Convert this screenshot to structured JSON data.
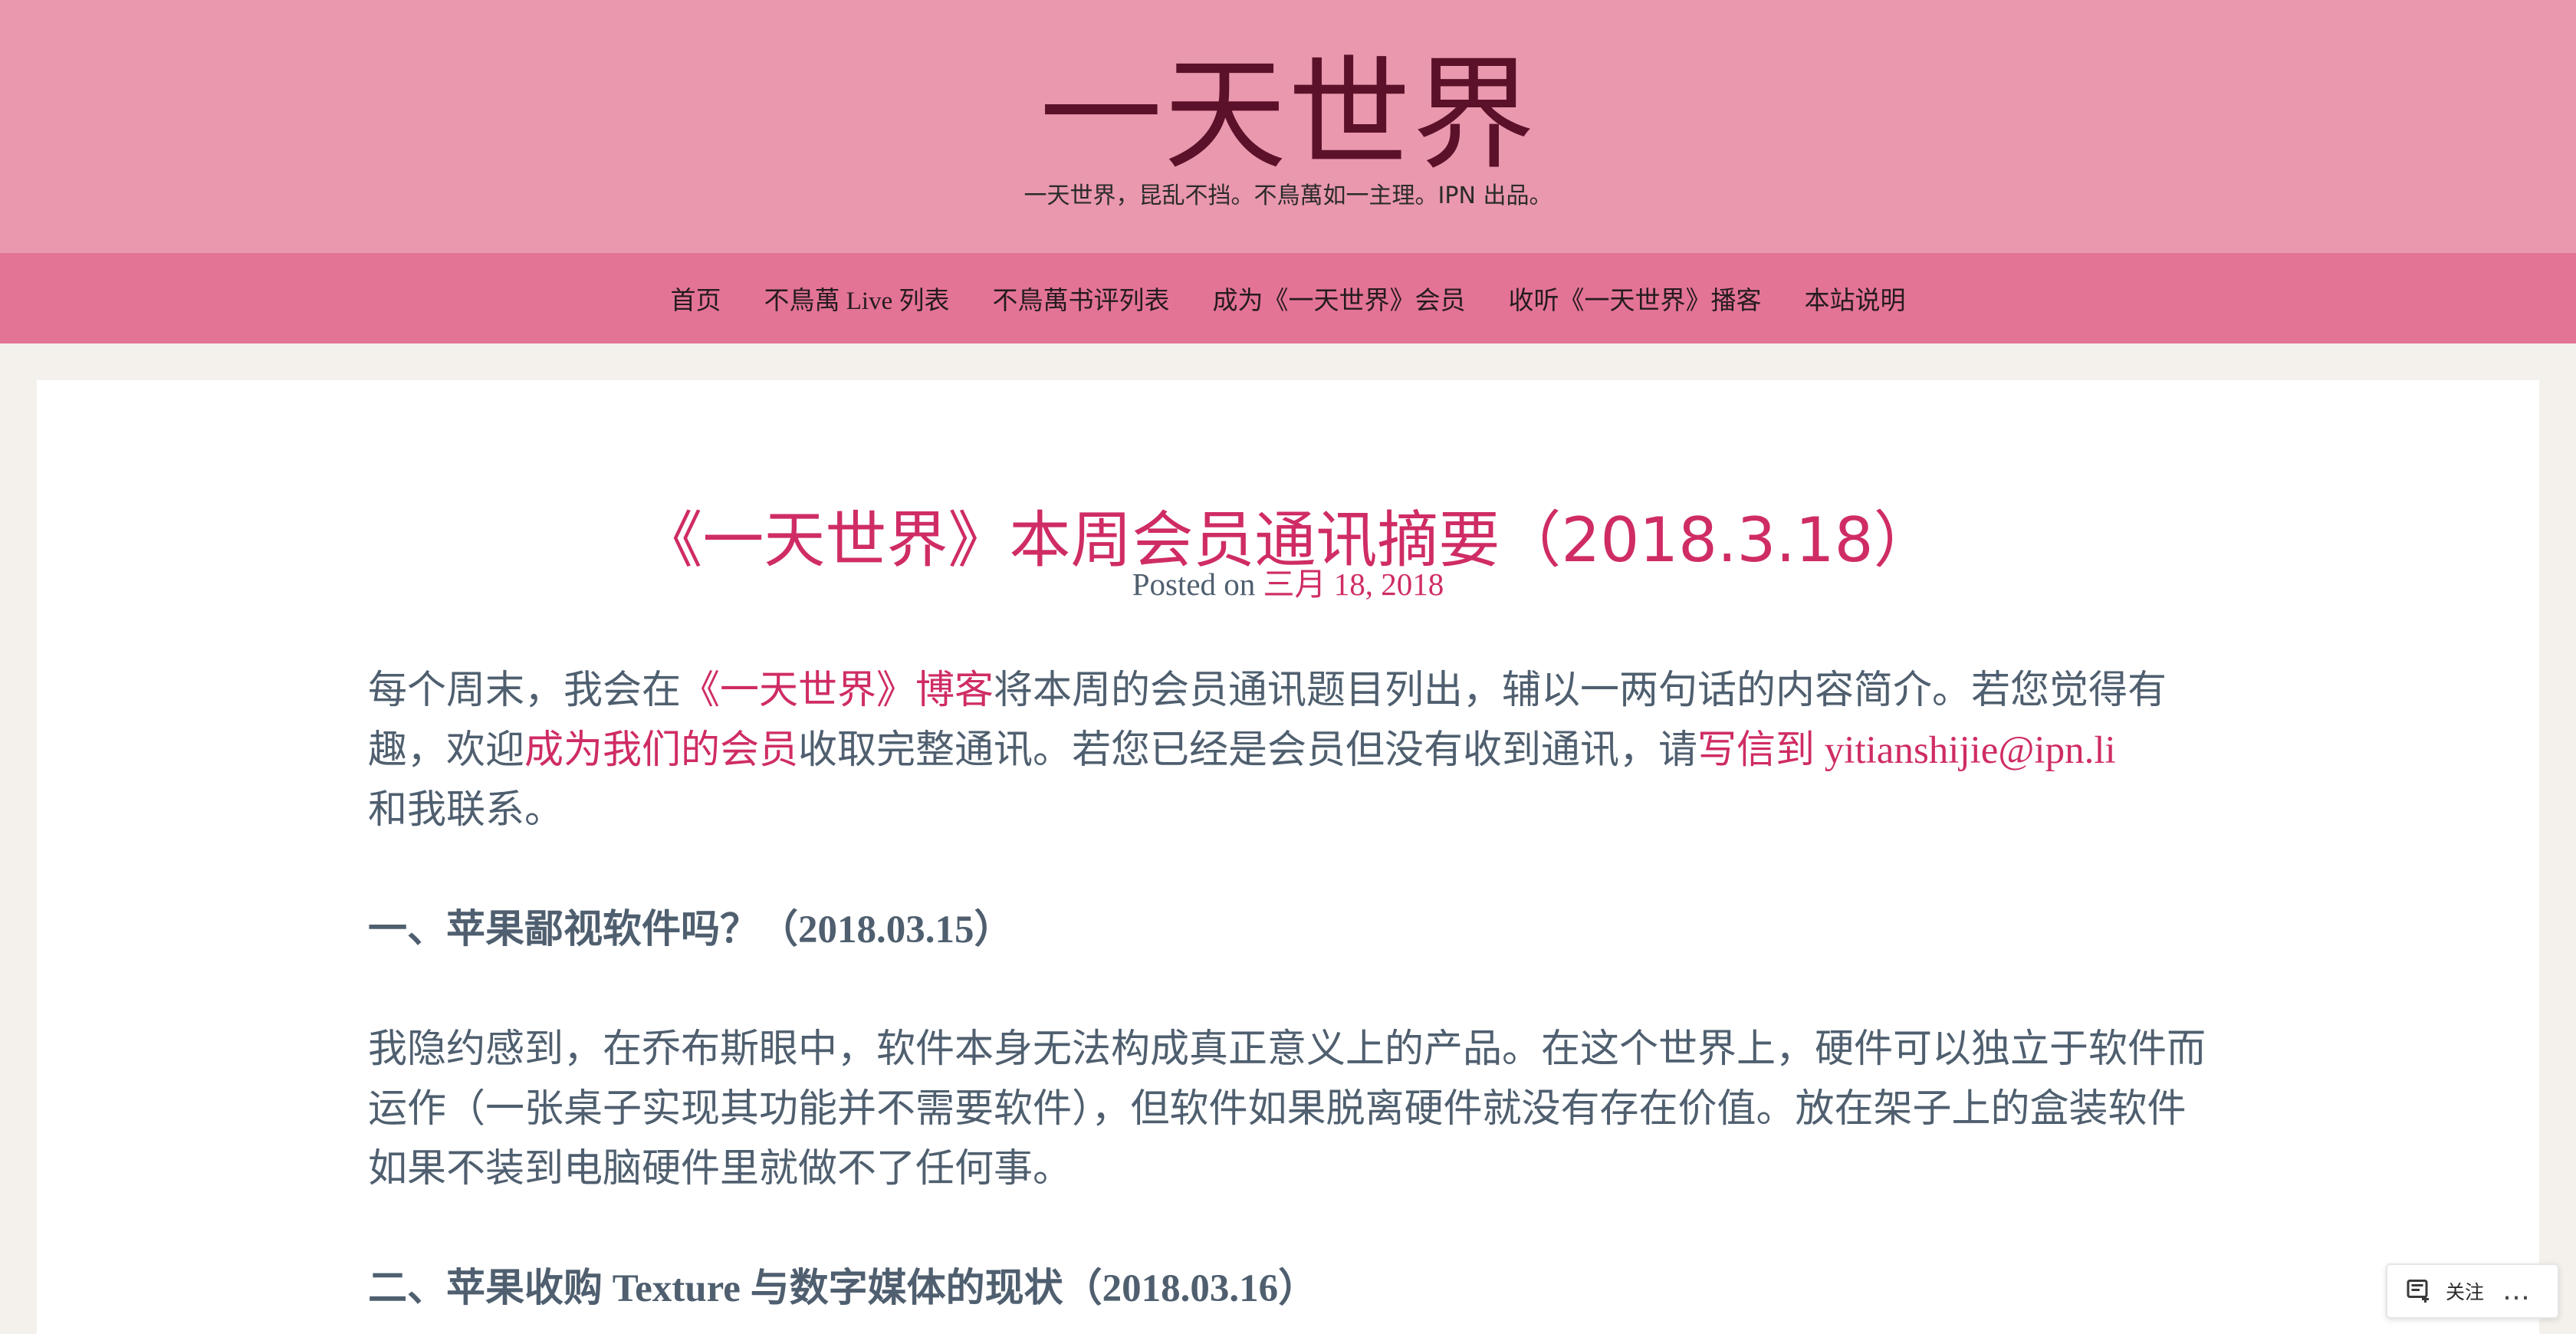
{
  "header": {
    "site_title": "一天世界",
    "site_description": "一天世界，昆乱不挡。不鳥萬如一主理。IPN 出品。"
  },
  "nav": {
    "items": [
      {
        "label": "首页"
      },
      {
        "label": "不鳥萬 Live 列表"
      },
      {
        "label": "不鳥萬书评列表"
      },
      {
        "label": "成为《一天世界》会员"
      },
      {
        "label": "收听《一天世界》播客"
      },
      {
        "label": "本站说明"
      }
    ]
  },
  "post": {
    "title": "《一天世界》本周会员通讯摘要（2018.3.18）",
    "meta_prefix": "Posted on ",
    "meta_date": "三月 18, 2018",
    "intro": {
      "t1": "每个周末，我会在",
      "link1": "《一天世界》博客",
      "t2": "将本周的会员通讯题目列出，辅以一两句话的内容简介。若您觉得有趣，欢迎",
      "link2": "成为我们的会员",
      "t3": "收取完整通讯。若您已经是会员但没有收到通讯，请",
      "link3": "写信到 yitianshijie@ipn.li",
      "t4": "和我联系。"
    },
    "sections": [
      {
        "heading": "一、苹果鄙视软件吗？（2018.03.15）",
        "body": "我隐约感到，在乔布斯眼中，软件本身无法构成真正意义上的产品。在这个世界上，硬件可以独立于软件而运作（一张桌子实现其功能并不需要软件），但软件如果脱离硬件就没有存在价值。放在架子上的盒装软件如果不装到电脑硬件里就做不了任何事。"
      },
      {
        "heading": "二、苹果收购 Texture 与数字媒体的现状（2018.03.16）"
      }
    ]
  },
  "follow_widget": {
    "label": "关注",
    "more": "…",
    "icon": "reader-follow-icon"
  },
  "colors": {
    "header_bg": "#e998ae",
    "nav_bg": "#e37495",
    "accent": "#cf2c65",
    "title_dark": "#5b1129",
    "body_text": "#4f5f6f",
    "page_bg": "#f4f1ec"
  }
}
